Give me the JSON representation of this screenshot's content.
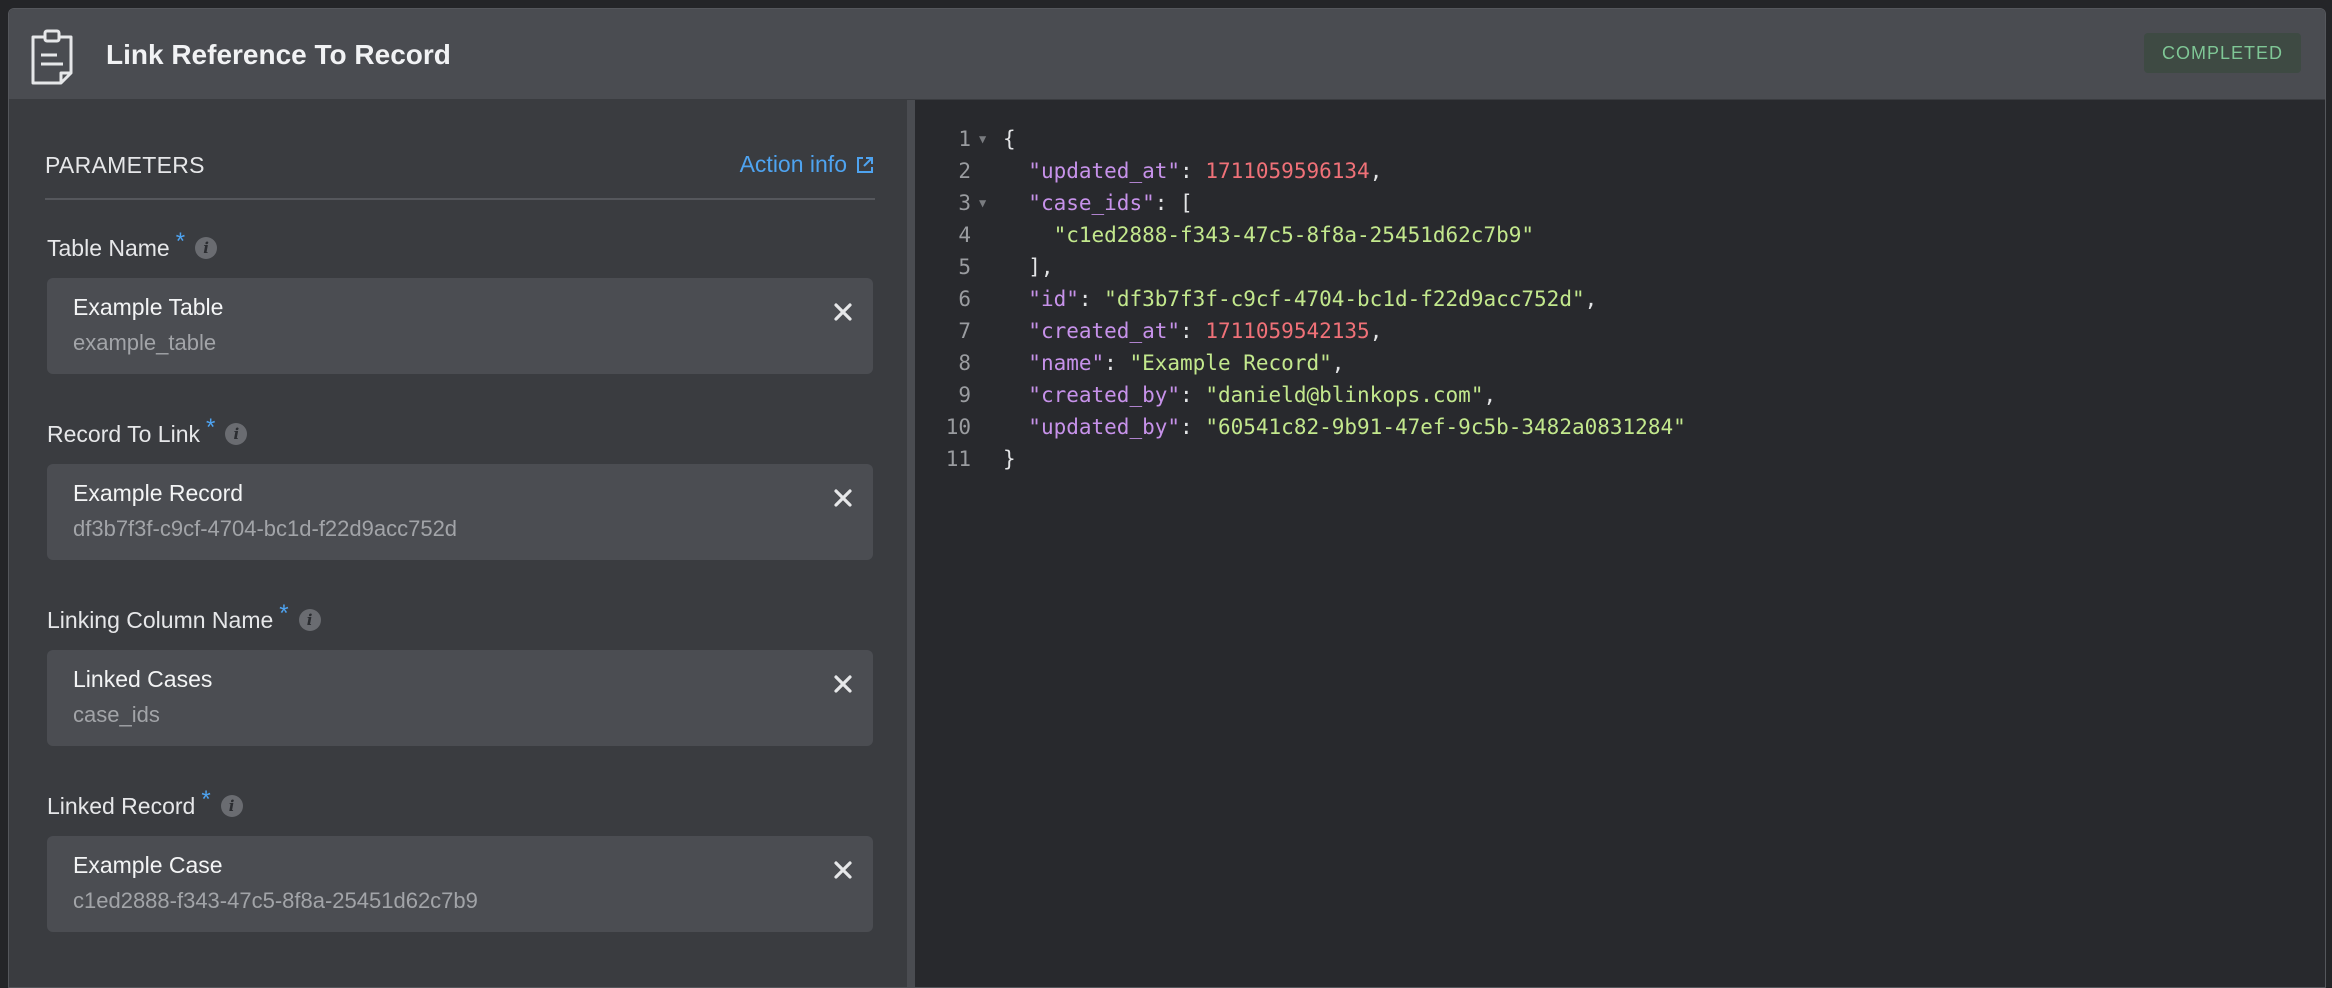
{
  "header": {
    "title": "Link Reference To Record",
    "status": "COMPLETED"
  },
  "parameters": {
    "title": "PARAMETERS",
    "action_info": "Action info",
    "fields": [
      {
        "label": "Table Name",
        "value": "Example Table",
        "sub": "example_table"
      },
      {
        "label": "Record To Link",
        "value": "Example Record",
        "sub": "df3b7f3f-c9cf-4704-bc1d-f22d9acc752d"
      },
      {
        "label": "Linking Column Name",
        "value": "Linked Cases",
        "sub": "case_ids"
      },
      {
        "label": "Linked Record",
        "value": "Example Case",
        "sub": "c1ed2888-f343-47c5-8f8a-25451d62c7b9"
      }
    ]
  },
  "code": {
    "lines": [
      {
        "n": "1",
        "fold": true,
        "tokens": [
          {
            "t": "{",
            "c": ""
          }
        ]
      },
      {
        "n": "2",
        "fold": false,
        "tokens": [
          {
            "t": "  ",
            "c": ""
          },
          {
            "t": "\"updated_at\"",
            "c": "k"
          },
          {
            "t": ": ",
            "c": ""
          },
          {
            "t": "1711059596134",
            "c": "n"
          },
          {
            "t": ",",
            "c": ""
          }
        ]
      },
      {
        "n": "3",
        "fold": true,
        "tokens": [
          {
            "t": "  ",
            "c": ""
          },
          {
            "t": "\"case_ids\"",
            "c": "k"
          },
          {
            "t": ": [",
            "c": ""
          }
        ]
      },
      {
        "n": "4",
        "fold": false,
        "tokens": [
          {
            "t": "    ",
            "c": ""
          },
          {
            "t": "\"c1ed2888-f343-47c5-8f8a-25451d62c7b9\"",
            "c": "s"
          }
        ]
      },
      {
        "n": "5",
        "fold": false,
        "tokens": [
          {
            "t": "  ],",
            "c": ""
          }
        ]
      },
      {
        "n": "6",
        "fold": false,
        "tokens": [
          {
            "t": "  ",
            "c": ""
          },
          {
            "t": "\"id\"",
            "c": "k"
          },
          {
            "t": ": ",
            "c": ""
          },
          {
            "t": "\"df3b7f3f-c9cf-4704-bc1d-f22d9acc752d\"",
            "c": "s"
          },
          {
            "t": ",",
            "c": ""
          }
        ]
      },
      {
        "n": "7",
        "fold": false,
        "tokens": [
          {
            "t": "  ",
            "c": ""
          },
          {
            "t": "\"created_at\"",
            "c": "k"
          },
          {
            "t": ": ",
            "c": ""
          },
          {
            "t": "1711059542135",
            "c": "n"
          },
          {
            "t": ",",
            "c": ""
          }
        ]
      },
      {
        "n": "8",
        "fold": false,
        "tokens": [
          {
            "t": "  ",
            "c": ""
          },
          {
            "t": "\"name\"",
            "c": "k"
          },
          {
            "t": ": ",
            "c": ""
          },
          {
            "t": "\"Example Record\"",
            "c": "s"
          },
          {
            "t": ",",
            "c": ""
          }
        ]
      },
      {
        "n": "9",
        "fold": false,
        "tokens": [
          {
            "t": "  ",
            "c": ""
          },
          {
            "t": "\"created_by\"",
            "c": "k"
          },
          {
            "t": ": ",
            "c": ""
          },
          {
            "t": "\"danield@blinkops.com\"",
            "c": "s"
          },
          {
            "t": ",",
            "c": ""
          }
        ]
      },
      {
        "n": "10",
        "fold": false,
        "tokens": [
          {
            "t": "  ",
            "c": ""
          },
          {
            "t": "\"updated_by\"",
            "c": "k"
          },
          {
            "t": ": ",
            "c": ""
          },
          {
            "t": "\"60541c82-9b91-47ef-9c5b-3482a0831284\"",
            "c": "s"
          }
        ]
      },
      {
        "n": "11",
        "fold": false,
        "tokens": [
          {
            "t": "}",
            "c": ""
          }
        ]
      }
    ]
  }
}
